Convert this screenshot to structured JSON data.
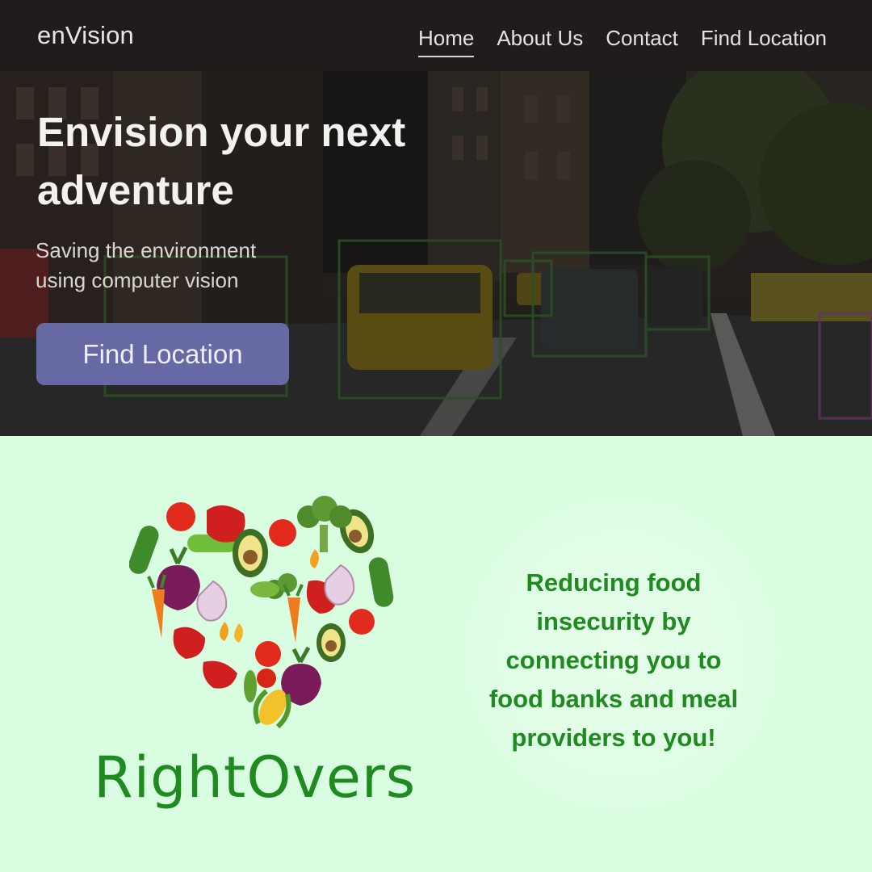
{
  "envision": {
    "brand": "enVision",
    "nav": [
      {
        "label": "Home",
        "active": true
      },
      {
        "label": "About Us",
        "active": false
      },
      {
        "label": "Contact",
        "active": false
      },
      {
        "label": "Find Location",
        "active": false
      }
    ],
    "hero": {
      "title": "Envision your next\nadventure",
      "subtitle": "Saving the environment\nusing computer vision",
      "cta_label": "Find Location"
    },
    "colors": {
      "navbar": "#1f1c1b",
      "cta": "#6669a3"
    }
  },
  "rightovers": {
    "logo_text": "RightOvers",
    "tagline": "Reducing food\ninsecurity by\nconnecting you to\nfood banks and meal\nproviders to you!",
    "colors": {
      "background": "#d8fde0",
      "text": "#1f8a1f"
    },
    "heart_icons": [
      "tomato-icon",
      "bell-pepper-icon",
      "cucumber-icon",
      "avocado-icon",
      "broccoli-icon",
      "beet-icon",
      "garlic-icon",
      "carrot-icon",
      "pea-pod-icon",
      "corn-icon"
    ]
  }
}
